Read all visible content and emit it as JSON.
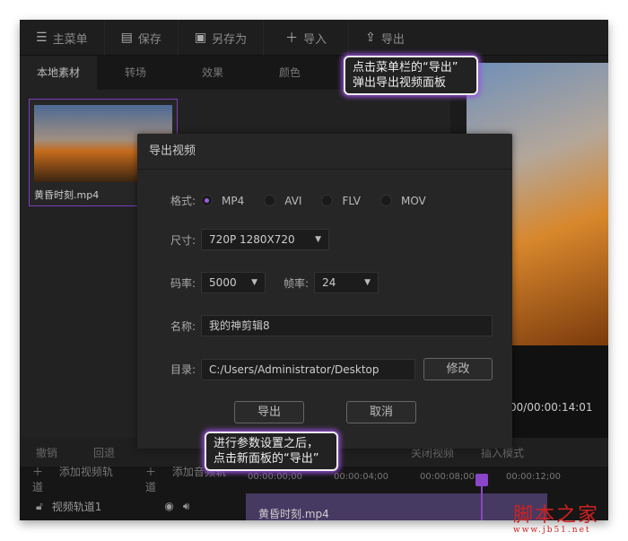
{
  "toolbar": {
    "items": [
      {
        "icon": "menu-icon",
        "label": "主菜单"
      },
      {
        "icon": "save-icon",
        "label": "保存"
      },
      {
        "icon": "save-as-icon",
        "label": "另存为"
      },
      {
        "icon": "plus-icon",
        "label": "导入"
      },
      {
        "icon": "upload-icon",
        "label": "导出"
      }
    ]
  },
  "tabs": [
    "本地素材",
    "转场",
    "效果",
    "颜色"
  ],
  "media": {
    "file": "黄昏时刻.mp4"
  },
  "preview": {
    "time": "00/00:00:14:01"
  },
  "timeline": {
    "tools": [
      "撤销",
      "回退",
      "",
      "关闭视频",
      "插入模式"
    ],
    "add_video": "添加视频轨道",
    "add_audio": "添加音频轨道",
    "ticks": [
      "00:00:00;00",
      "00:00:04;00",
      "00:00:08;00",
      "00:00:12;00"
    ],
    "track": "视频轨道1",
    "clip": "黄昏时刻.mp4"
  },
  "dialog": {
    "title": "导出视频",
    "format_label": "格式:",
    "formats": [
      "MP4",
      "AVI",
      "FLV",
      "MOV"
    ],
    "size_label": "尺寸:",
    "size": "720P 1280X720",
    "bitrate_label": "码率:",
    "bitrate": "5000",
    "fps_label": "帧率:",
    "fps": "24",
    "name_label": "名称:",
    "name": "我的神剪辑8",
    "dir_label": "目录:",
    "dir": "C:/Users/Administrator/Desktop",
    "modify": "修改",
    "export": "导出",
    "cancel": "取消"
  },
  "tips": {
    "t1a": "点击菜单栏的“导出”",
    "t1b": "弹出导出视频面板",
    "t2a": "进行参数设置之后，",
    "t2b": "点击新面板的“导出”"
  },
  "watermark": {
    "a": "脚本之家",
    "b": "www.jb51.net"
  },
  "colors": {
    "accent": "#9b4fe0"
  }
}
